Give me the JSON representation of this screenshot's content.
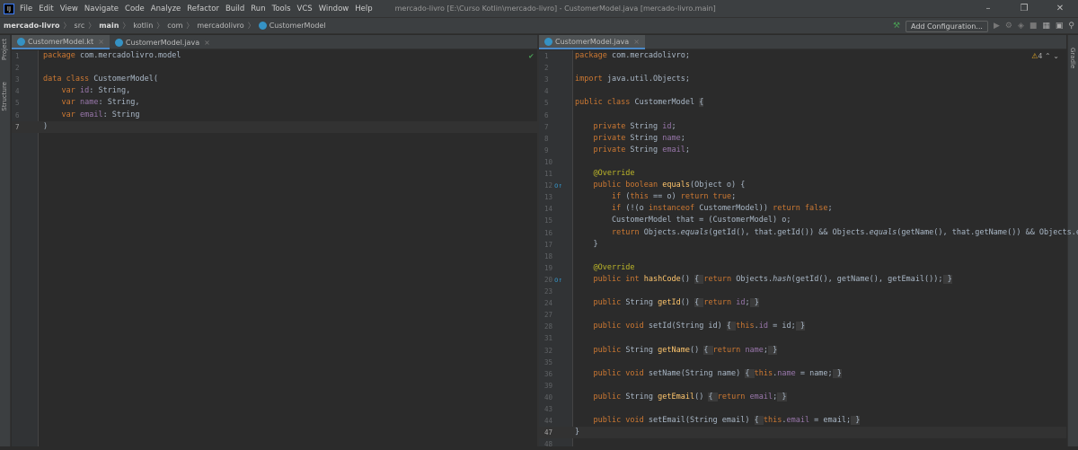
{
  "menubar": {
    "logo": "IJ",
    "items": [
      "File",
      "Edit",
      "View",
      "Navigate",
      "Code",
      "Analyze",
      "Refactor",
      "Build",
      "Run",
      "Tools",
      "VCS",
      "Window",
      "Help"
    ],
    "title": "mercado-livro [E:\\Curso Kotlin\\mercado-livro] - CustomerModel.java [mercado-livro.main]"
  },
  "breadcrumb": [
    "mercado-livro",
    "src",
    "main",
    "kotlin",
    "com",
    "mercadolivro",
    "CustomerModel"
  ],
  "toolbar": {
    "add_config": "Add Configuration..."
  },
  "side": {
    "project": "Project",
    "structure": "Structure",
    "gradle": "Gradle"
  },
  "left_tabs": [
    "CustomerModel.kt",
    "CustomerModel.java"
  ],
  "right_tabs": [
    "CustomerModel.java"
  ],
  "inspection": {
    "warnings": "4"
  },
  "kotlin_lines": [
    {
      "n": "1",
      "html": "<span class=kw>package</span> com.mercadolivro.model"
    },
    {
      "n": "2",
      "html": ""
    },
    {
      "n": "3",
      "html": "<span class=kw>data class</span> CustomerModel("
    },
    {
      "n": "4",
      "html": "    <span class=kw>var</span> <span class=pr ul>id</span>: String,"
    },
    {
      "n": "5",
      "html": "    <span class=kw>var</span> <span class=pr ul>name</span>: String,"
    },
    {
      "n": "6",
      "html": "    <span class=kw>var</span> <span class=pr ul>email</span>: String"
    },
    {
      "n": "7",
      "html": ")"
    }
  ],
  "java_lines": [
    {
      "n": "1",
      "html": "<span class=kw>package</span> com.mercadolivro;"
    },
    {
      "n": "2",
      "html": ""
    },
    {
      "n": "3",
      "html": "<span class=kw>import</span> java.util.Objects;"
    },
    {
      "n": "4",
      "html": ""
    },
    {
      "n": "5",
      "html": "<span class=kw>public class</span> CustomerModel <span class=fold>{</span>"
    },
    {
      "n": "6",
      "html": ""
    },
    {
      "n": "7",
      "html": "    <span class=kw>private</span> String <span class=pr>id</span>;"
    },
    {
      "n": "8",
      "html": "    <span class=kw>private</span> String <span class=pr>name</span>;"
    },
    {
      "n": "9",
      "html": "    <span class=kw>private</span> String <span class=pr>email</span>;"
    },
    {
      "n": "10",
      "html": ""
    },
    {
      "n": "11",
      "html": "    <span class=ann>@Override</span>"
    },
    {
      "n": "12",
      "html": "    <span class=kw>public boolean</span> <span class=fn>equals</span>(Object o) {"
    },
    {
      "n": "13",
      "html": "        <span class=kw>if</span> (<span class=kw>this</span> == o) <span class=kw>return true</span>;"
    },
    {
      "n": "14",
      "html": "        <span class=kw>if</span> (!(o <span class=kw>instanceof</span> CustomerModel)) <span class=kw>return false</span>;"
    },
    {
      "n": "15",
      "html": "        CustomerModel that = (CustomerModel) o;"
    },
    {
      "n": "16",
      "html": "        <span class=kw>return</span> Objects.<span class=it>equals</span>(getId(), that.getId()) &amp;&amp; Objects.<span class=it>equals</span>(getName(), that.getName()) &amp;&amp; Objects.e"
    },
    {
      "n": "17",
      "html": "    }"
    },
    {
      "n": "18",
      "html": ""
    },
    {
      "n": "19",
      "html": "    <span class=ann>@Override</span>"
    },
    {
      "n": "20",
      "html": "    <span class=kw>public int</span> <span class=fn>hashCode</span>() <span class=fold>{ </span><span class=kw>return</span> Objects.<span class=it>hash</span>(getId(), getName(), getEmail());<span class=fold> }</span>"
    },
    {
      "n": "23",
      "html": ""
    },
    {
      "n": "24",
      "html": "    <span class=kw>public</span> String <span class=fn>getId</span>() <span class=fold>{ </span><span class=kw>return</span> <span class=pr>id</span>;<span class=fold> }</span>"
    },
    {
      "n": "27",
      "html": ""
    },
    {
      "n": "28",
      "html": "    <span class=kw>public void</span> setId(String id) <span class=fold>{ </span><span class=kw>this</span>.<span class=pr>id</span> = id;<span class=fold> }</span>"
    },
    {
      "n": "31",
      "html": ""
    },
    {
      "n": "32",
      "html": "    <span class=kw>public</span> String <span class=fn>getName</span>() <span class=fold>{ </span><span class=kw>return</span> <span class=pr>name</span>;<span class=fold> }</span>"
    },
    {
      "n": "35",
      "html": ""
    },
    {
      "n": "36",
      "html": "    <span class=kw>public void</span> setName(String name) <span class=fold>{ </span><span class=kw>this</span>.<span class=pr>name</span> = name;<span class=fold> }</span>"
    },
    {
      "n": "39",
      "html": ""
    },
    {
      "n": "40",
      "html": "    <span class=kw>public</span> String <span class=fn>getEmail</span>() <span class=fold>{ </span><span class=kw>return</span> <span class=pr>email</span>;<span class=fold> }</span>"
    },
    {
      "n": "43",
      "html": ""
    },
    {
      "n": "44",
      "html": "    <span class=kw>public void</span> setEmail(String email) <span class=fold>{ </span><span class=kw>this</span>.<span class=pr>email</span> = email;<span class=fold> }</span>"
    },
    {
      "n": "47",
      "html": "}"
    },
    {
      "n": "48",
      "html": ""
    }
  ]
}
